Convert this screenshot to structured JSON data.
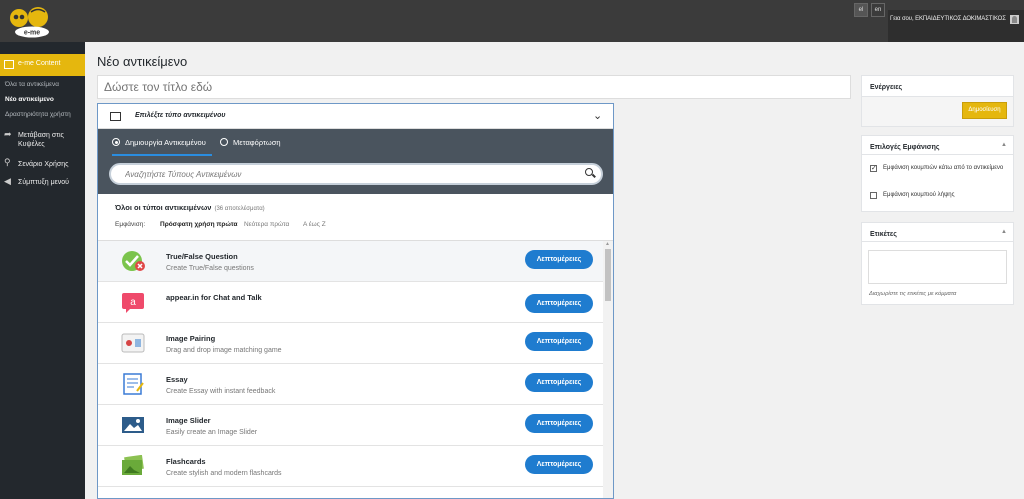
{
  "topbar": {
    "logo_text": "e-me",
    "lang_el": "el",
    "lang_en": "en",
    "greeting": "Γεια σου, ΕΚΠΑΙΔΕΥΤΙΚΟΣ ΔΟΚΙΜΑΣΤΙΚΟΣ"
  },
  "sidebar": {
    "active_label": "e-me Content",
    "sub_items": [
      "Όλα τα αντικείμενα",
      "Νέο αντικείμενο",
      "Δραστηριότητα χρήστη"
    ],
    "items": [
      {
        "label": "Μετάβαση στις Κυψέλες",
        "icon": "arrow-icon"
      },
      {
        "label": "Σενάριο Χρήσης",
        "icon": "lightbulb-icon"
      },
      {
        "label": "Σύμπτυξη μενού",
        "icon": "collapse-icon"
      }
    ]
  },
  "main": {
    "page_title": "Νέο αντικείμενο",
    "title_placeholder": "Δώστε τον τίτλο εδώ"
  },
  "type_panel": {
    "header": "Επιλέξτε τύπο αντικειμένου",
    "tab_create": "Δημιουργία Αντικειμένου",
    "tab_upload": "Μεταφόρτωση",
    "search_placeholder": "Αναζητήστε Τύπους Αντικειμένων",
    "all_types": "Όλοι οι τύποι αντικειμένων",
    "count": "(36 αποτελέσματα)",
    "show_label": "Εμφάνιση:",
    "sort_recent": "Πρόσφατη χρήση πρώτα",
    "sort_newest": "Νεότερα πρώτα",
    "sort_az": "Α έως Ζ",
    "details_label": "Λεπτομέρειες",
    "items": [
      {
        "name": "True/False Question",
        "desc": "Create True/False questions",
        "icon": "true-false-icon"
      },
      {
        "name": "appear.in for Chat and Talk",
        "desc": "",
        "icon": "appear-in-icon"
      },
      {
        "name": "Image Pairing",
        "desc": "Drag and drop image matching game",
        "icon": "image-pairing-icon"
      },
      {
        "name": "Essay",
        "desc": "Create Essay with instant feedback",
        "icon": "essay-icon"
      },
      {
        "name": "Image Slider",
        "desc": "Easily create an Image Slider",
        "icon": "image-slider-icon"
      },
      {
        "name": "Flashcards",
        "desc": "Create stylish and modern flashcards",
        "icon": "flashcards-icon"
      }
    ]
  },
  "right": {
    "actions_title": "Ενέργειες",
    "publish_label": "Δημοσίευση",
    "display_title": "Επιλογές Εμφάνισης",
    "opt1": "Εμφάνιση κουμπιών κάτω από το αντικείμενο",
    "opt2": "Εμφάνιση κουμπιού λήψης",
    "tags_title": "Ετικέτες",
    "tags_hint": "Διαχωρίστε τις ετικέτες με κόμματα"
  },
  "colors": {
    "accent": "#e5b70e",
    "button_blue": "#1f7ccf",
    "sidebar_bg": "#23282d",
    "panel_bar": "#4a545e"
  }
}
